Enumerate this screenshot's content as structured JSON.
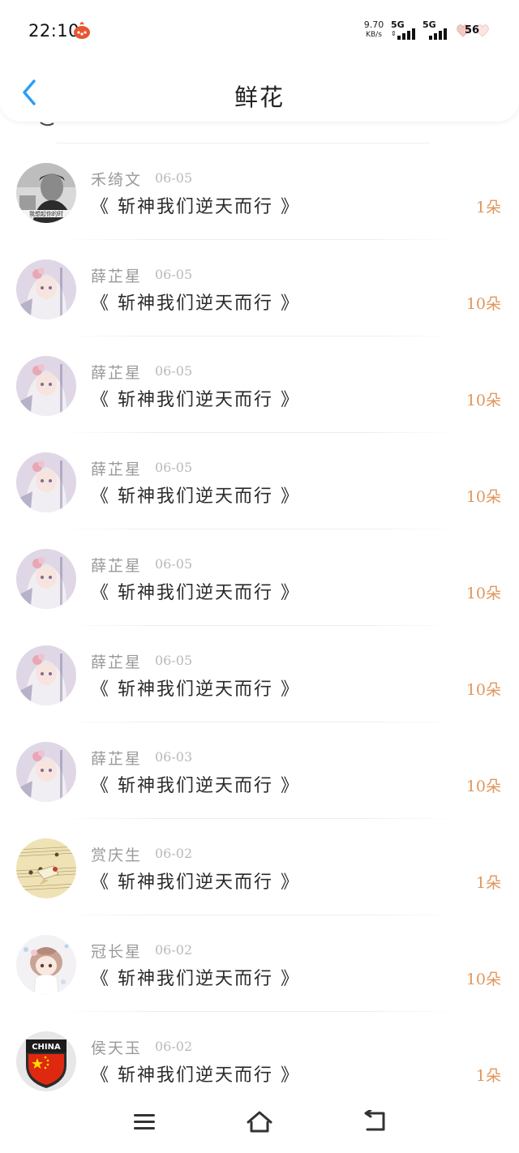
{
  "status_bar": {
    "time": "22:10",
    "net_speed_value": "9.70",
    "net_speed_unit": "KB/s",
    "signal1_label": "5G",
    "signal2_label": "5G",
    "battery_level": "56"
  },
  "header": {
    "title": "鲜花"
  },
  "colors": {
    "accent_blue": "#2a9df4",
    "count_orange": "#e0965c",
    "name_gray": "#9a9a9a"
  },
  "list": {
    "items": [
      {
        "user": "禾绮文",
        "date": "06-05",
        "book": "《 斩神我们逆天而行 》",
        "count": "1朵",
        "avatar": "photo-boy-avatar"
      },
      {
        "user": "薛芷星",
        "date": "06-05",
        "book": "《 斩神我们逆天而行 》",
        "count": "10朵",
        "avatar": "anime-girl-avatar"
      },
      {
        "user": "薛芷星",
        "date": "06-05",
        "book": "《 斩神我们逆天而行 》",
        "count": "10朵",
        "avatar": "anime-girl-avatar"
      },
      {
        "user": "薛芷星",
        "date": "06-05",
        "book": "《 斩神我们逆天而行 》",
        "count": "10朵",
        "avatar": "anime-girl-avatar"
      },
      {
        "user": "薛芷星",
        "date": "06-05",
        "book": "《 斩神我们逆天而行 》",
        "count": "10朵",
        "avatar": "anime-girl-avatar"
      },
      {
        "user": "薛芷星",
        "date": "06-05",
        "book": "《 斩神我们逆天而行 》",
        "count": "10朵",
        "avatar": "anime-girl-avatar"
      },
      {
        "user": "薛芷星",
        "date": "06-03",
        "book": "《 斩神我们逆天而行 》",
        "count": "10朵",
        "avatar": "anime-girl-avatar"
      },
      {
        "user": "赏庆生",
        "date": "06-02",
        "book": "《 斩神我们逆天而行 》",
        "count": "1朵",
        "avatar": "music-sheet-avatar"
      },
      {
        "user": "冠长星",
        "date": "06-02",
        "book": "《 斩神我们逆天而行 》",
        "count": "10朵",
        "avatar": "chibi-girl-avatar"
      },
      {
        "user": "侯天玉",
        "date": "06-02",
        "book": "《 斩神我们逆天而行 》",
        "count": "1朵",
        "avatar": "china-flag-avatar"
      }
    ]
  },
  "avatar_badges": {
    "photo_caption": "我想起你的时",
    "china_label": "CHINA"
  },
  "nav": {
    "menu_icon": "menu-icon",
    "home_icon": "home-icon",
    "back_icon": "return-icon"
  }
}
